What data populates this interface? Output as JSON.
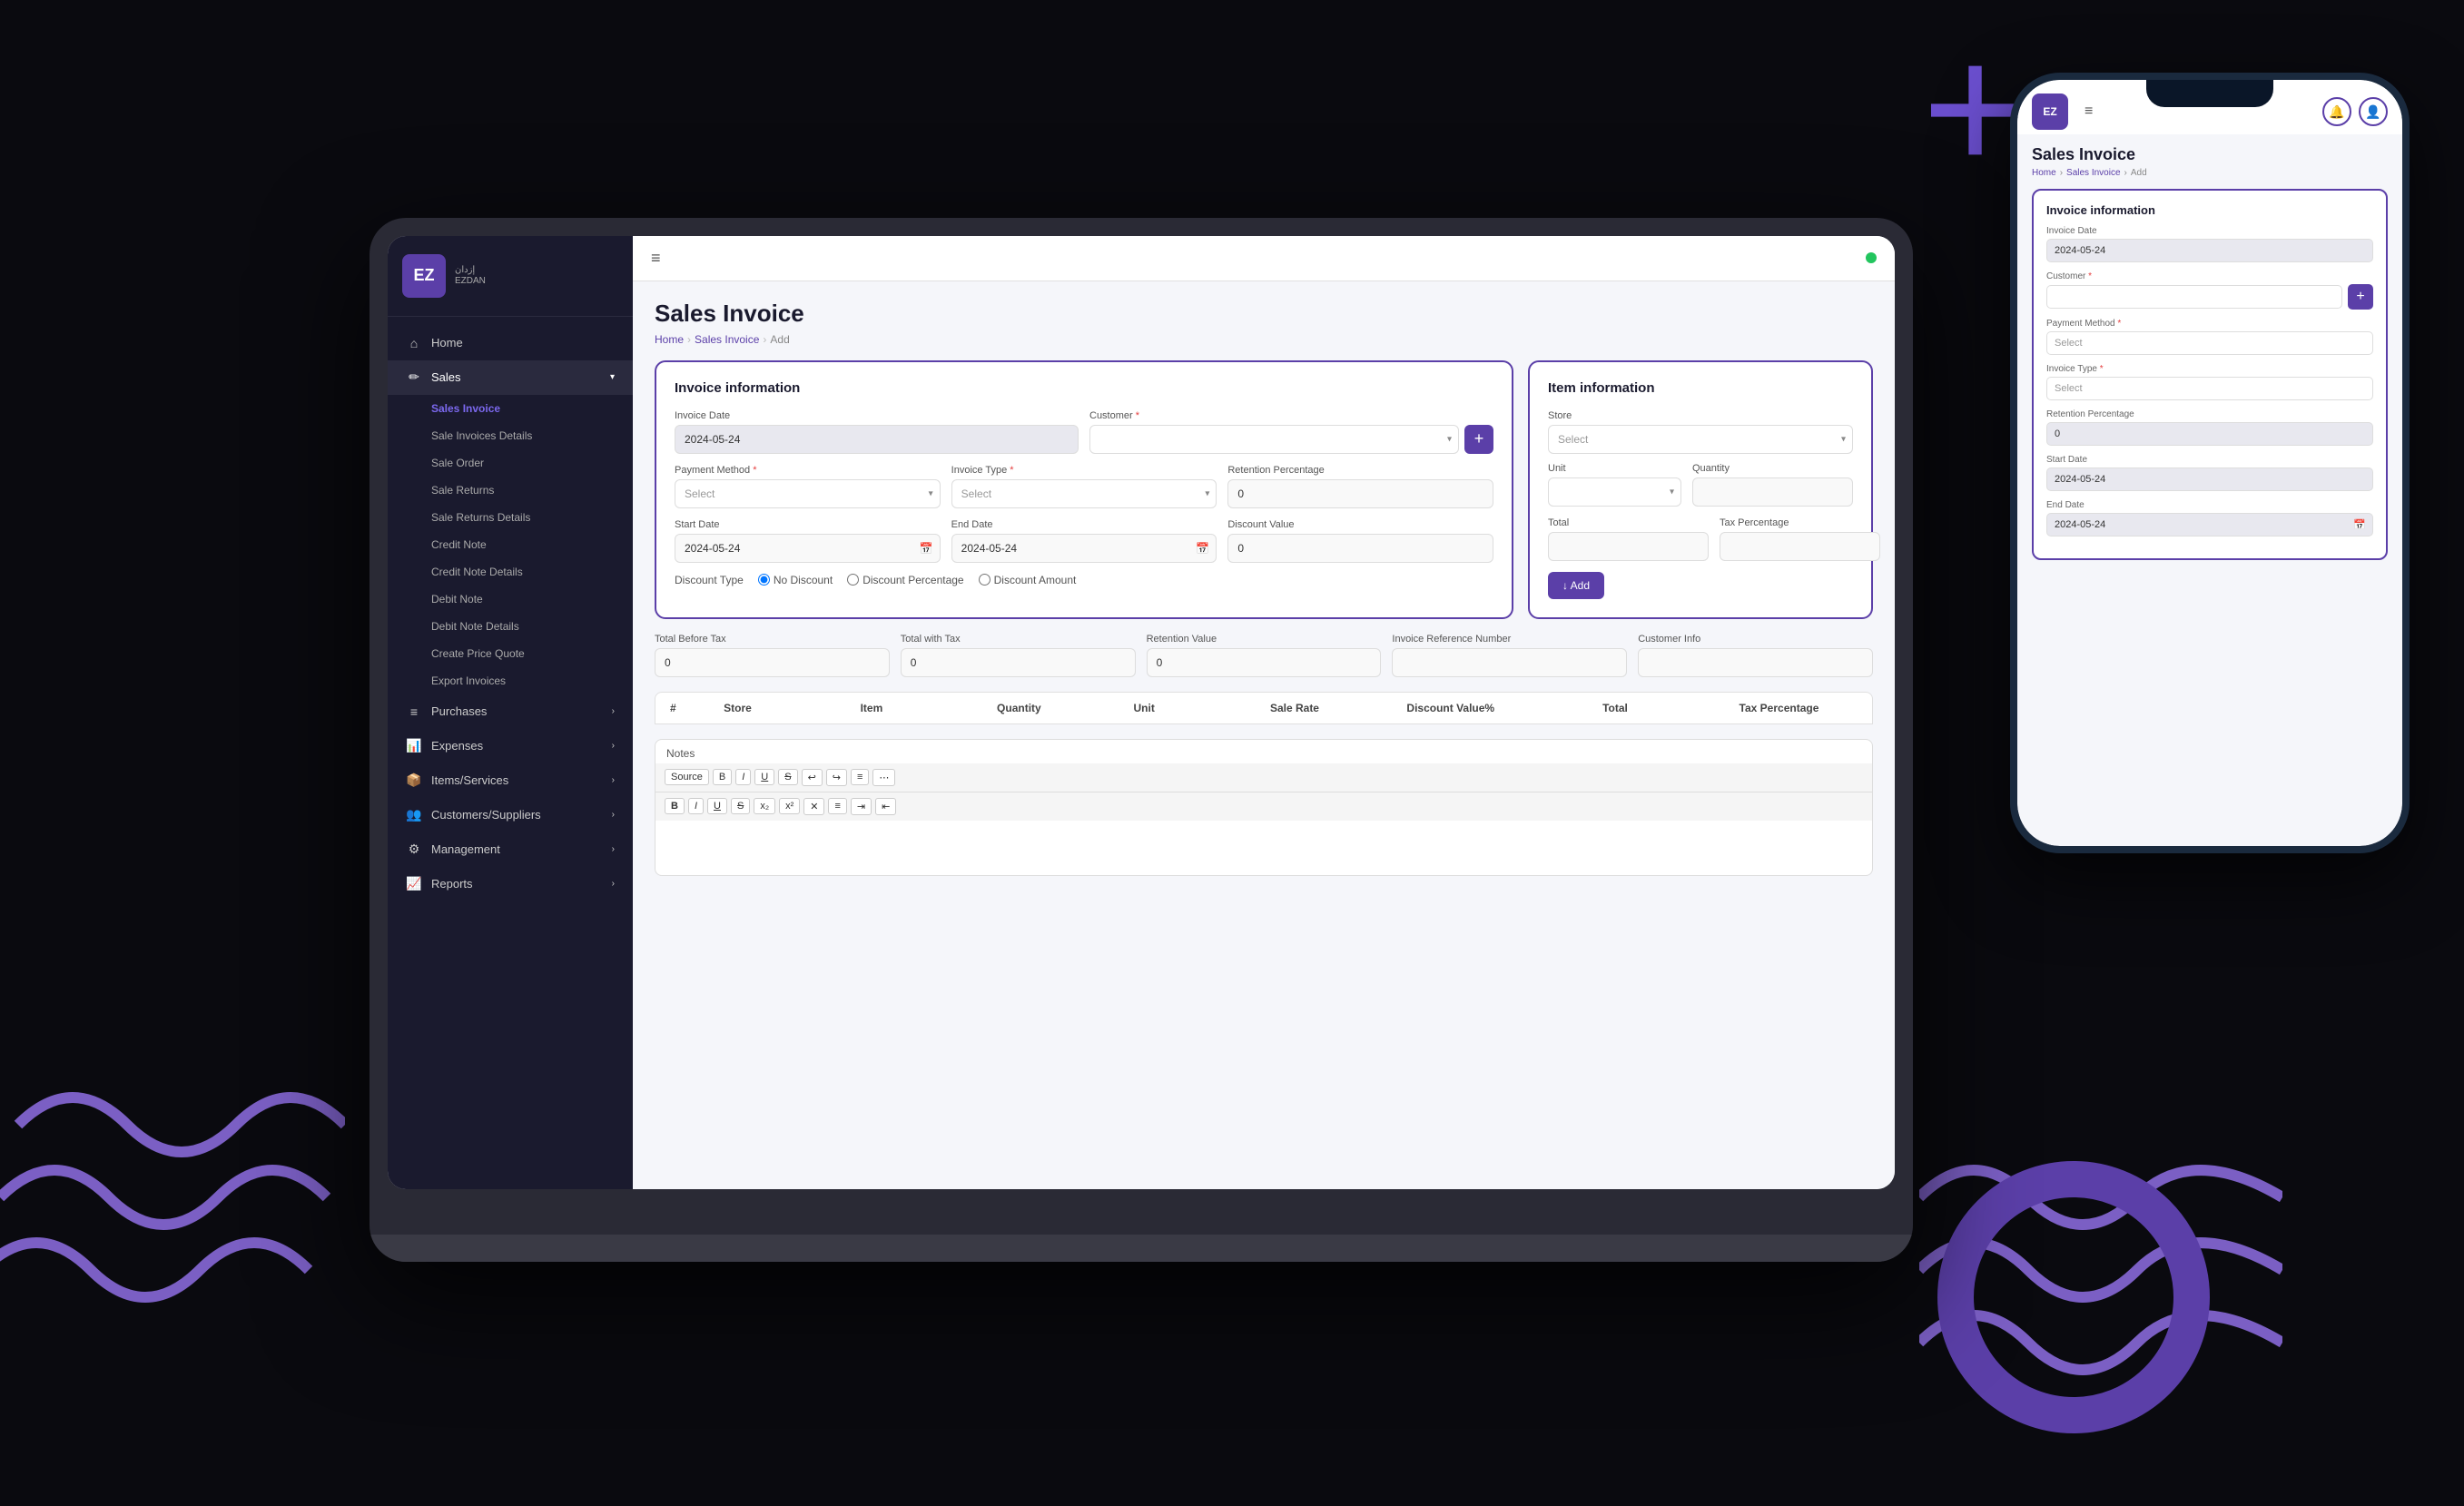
{
  "background": {
    "plus_symbol": "+",
    "accent_color": "#6b4fcf"
  },
  "laptop": {
    "topbar": {
      "hamburger": "≡",
      "status_dot_color": "#22c55e"
    },
    "sidebar": {
      "logo": {
        "icon_text": "EZ",
        "name": "إزدان",
        "subtitle": "EZDAN"
      },
      "nav_items": [
        {
          "id": "home",
          "label": "Home",
          "icon": "⌂",
          "active": false
        },
        {
          "id": "sales",
          "label": "Sales",
          "icon": "🗒",
          "active": true,
          "has_arrow": true
        },
        {
          "id": "sales-invoice",
          "label": "Sales Invoice",
          "sub": true,
          "active": true
        },
        {
          "id": "sale-invoices-details",
          "label": "Sale Invoices Details",
          "sub": true
        },
        {
          "id": "sale-order",
          "label": "Sale Order",
          "sub": true
        },
        {
          "id": "sale-returns",
          "label": "Sale Returns",
          "sub": true
        },
        {
          "id": "sale-returns-details",
          "label": "Sale Returns Details",
          "sub": true
        },
        {
          "id": "credit-note",
          "label": "Credit Note",
          "sub": true
        },
        {
          "id": "credit-note-details",
          "label": "Credit Note Details",
          "sub": true
        },
        {
          "id": "debit-note",
          "label": "Debit Note",
          "sub": true
        },
        {
          "id": "debit-note-details",
          "label": "Debit Note Details",
          "sub": true
        },
        {
          "id": "create-price-quote",
          "label": "Create Price Quote",
          "sub": true
        },
        {
          "id": "export-invoices",
          "label": "Export Invoices",
          "sub": true
        },
        {
          "id": "purchases",
          "label": "Purchases",
          "icon": "≡",
          "has_arrow": true
        },
        {
          "id": "expenses",
          "label": "Expenses",
          "icon": "📊",
          "has_arrow": true
        },
        {
          "id": "items-services",
          "label": "Items/Services",
          "icon": "📦",
          "has_arrow": true
        },
        {
          "id": "customers-suppliers",
          "label": "Customers/Suppliers",
          "icon": "👥",
          "has_arrow": true
        },
        {
          "id": "management",
          "label": "Management",
          "icon": "⚙",
          "has_arrow": true
        },
        {
          "id": "reports",
          "label": "Reports",
          "icon": "📈",
          "has_arrow": true
        }
      ]
    },
    "main": {
      "page_title": "Sales Invoice",
      "breadcrumb": [
        "Home",
        "Sales Invoice",
        "Add"
      ],
      "invoice_info": {
        "title": "Invoice information",
        "invoice_date_label": "Invoice Date",
        "invoice_date_value": "2024-05-24",
        "customer_label": "Customer",
        "customer_required": true,
        "customer_placeholder": "",
        "payment_method_label": "Payment Method",
        "payment_method_required": true,
        "payment_method_placeholder": "Select",
        "invoice_type_label": "Invoice Type",
        "invoice_type_required": true,
        "invoice_type_placeholder": "Select",
        "retention_percentage_label": "Retention Percentage",
        "retention_percentage_value": "0",
        "start_date_label": "Start Date",
        "start_date_value": "2024-05-24",
        "end_date_label": "End Date",
        "end_date_value": "2024-05-24",
        "discount_value_label": "Discount Value",
        "discount_value_value": "0",
        "discount_type_label": "Discount Type",
        "discount_options": [
          "No Discount",
          "Discount Percentage",
          "Discount Amount"
        ],
        "discount_default": "No Discount"
      },
      "item_info": {
        "title": "Item information",
        "store_label": "Store",
        "store_placeholder": "Select",
        "unit_label": "Unit",
        "quantity_label": "Quantity",
        "total_label": "Total",
        "tax_percentage_label": "Tax Percentage",
        "add_button": "↓ Add"
      },
      "summary": {
        "total_before_tax_label": "Total Before Tax",
        "total_before_tax_value": "0",
        "total_with_tax_label": "Total with Tax",
        "total_with_tax_value": "0",
        "retention_value_label": "Retention Value",
        "retention_value_value": "0",
        "invoice_reference_label": "Invoice Reference Number",
        "customer_info_label": "Customer Info"
      },
      "table": {
        "columns": [
          "#",
          "Store",
          "Item",
          "Quantity",
          "Unit",
          "Sale Rate",
          "Discount Value%",
          "Total",
          "Tax Percentage"
        ]
      },
      "notes": {
        "label": "Notes",
        "source_btn": "Source",
        "editor_btns": [
          "B",
          "I",
          "U",
          "S",
          "x₂",
          "x²",
          "/",
          "↩",
          "↪",
          "¶",
          "«",
          "»"
        ]
      }
    }
  },
  "phone": {
    "page_title": "Sales Invoice",
    "breadcrumb": [
      "Home",
      "Sales Invoice",
      "Add"
    ],
    "invoice_info": {
      "title": "Invoice information",
      "invoice_date_label": "Invoice Date",
      "invoice_date_value": "2024-05-24",
      "customer_label": "Customer",
      "customer_required": true,
      "payment_method_label": "Payment Method",
      "payment_method_required": true,
      "payment_method_placeholder": "Select",
      "invoice_type_label": "Invoice Type",
      "invoice_type_required": true,
      "invoice_type_placeholder": "Select",
      "retention_label": "Retention Percentage",
      "retention_value": "0",
      "start_date_label": "Start Date",
      "start_date_value": "2024-05-24",
      "end_date_label": "End Date",
      "end_date_value": "2024-05-24"
    }
  }
}
